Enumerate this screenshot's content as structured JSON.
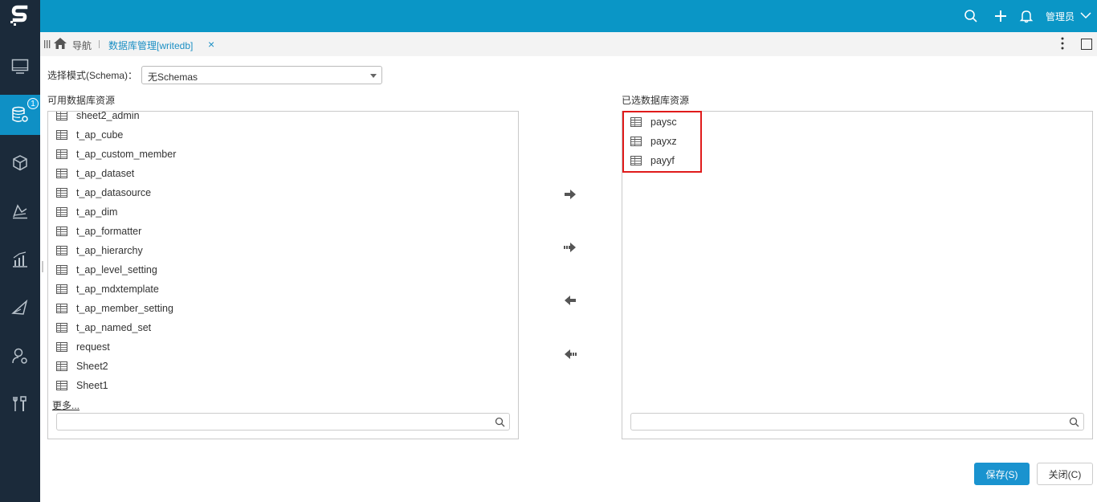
{
  "header": {
    "user_name": "管理员",
    "accent_color": "#0a96c6",
    "icons": [
      "search-icon",
      "plus-icon",
      "bell-icon",
      "chevron-down-icon"
    ]
  },
  "sidebar": {
    "badge": "1",
    "items": [
      "monitor-icon",
      "database-settings-icon",
      "cube-icon",
      "chart-area-icon",
      "bar-chart-icon",
      "send-icon",
      "user-settings-icon",
      "tools-icon"
    ]
  },
  "tabbar": {
    "nav_label": "导航",
    "tab_title": "数据库管理[writedb]",
    "close_glyph": "×"
  },
  "schema": {
    "label": "选择模式(Schema)：",
    "value": "无Schemas"
  },
  "available": {
    "title": "可用数据库资源",
    "items": [
      "sheet2_admin",
      "t_ap_cube",
      "t_ap_custom_member",
      "t_ap_dataset",
      "t_ap_datasource",
      "t_ap_dim",
      "t_ap_formatter",
      "t_ap_hierarchy",
      "t_ap_level_setting",
      "t_ap_mdxtemplate",
      "t_ap_member_setting",
      "t_ap_named_set",
      "request",
      "Sheet2",
      "Sheet1"
    ],
    "more_label": "更多...",
    "search_value": ""
  },
  "selected": {
    "title": "已选数据库资源",
    "items": [
      "paysc",
      "payxz",
      "payyf"
    ],
    "search_value": ""
  },
  "buttons": {
    "save": "保存(S)",
    "close": "关闭(C)"
  }
}
